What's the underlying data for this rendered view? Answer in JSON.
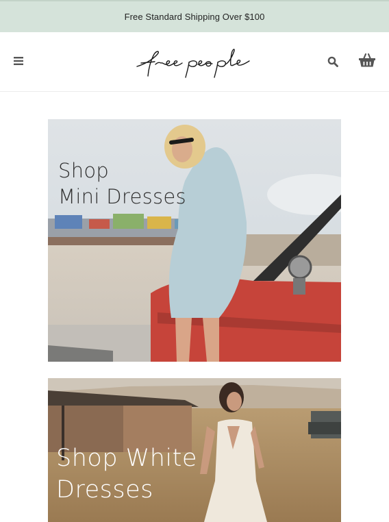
{
  "promo_bar": {
    "text": "Free Standard Shipping Over $100"
  },
  "header": {
    "logo_text": "free people",
    "menu_icon": "hamburger-icon",
    "search_icon": "search-icon",
    "cart_icon": "basket-icon"
  },
  "promos": [
    {
      "title": "Shop\nMini Dresses"
    },
    {
      "title": "Shop White\nDresses"
    }
  ],
  "colors": {
    "promo_bar_bg": "#d5e3da",
    "icon": "#555555",
    "text": "#222222"
  }
}
